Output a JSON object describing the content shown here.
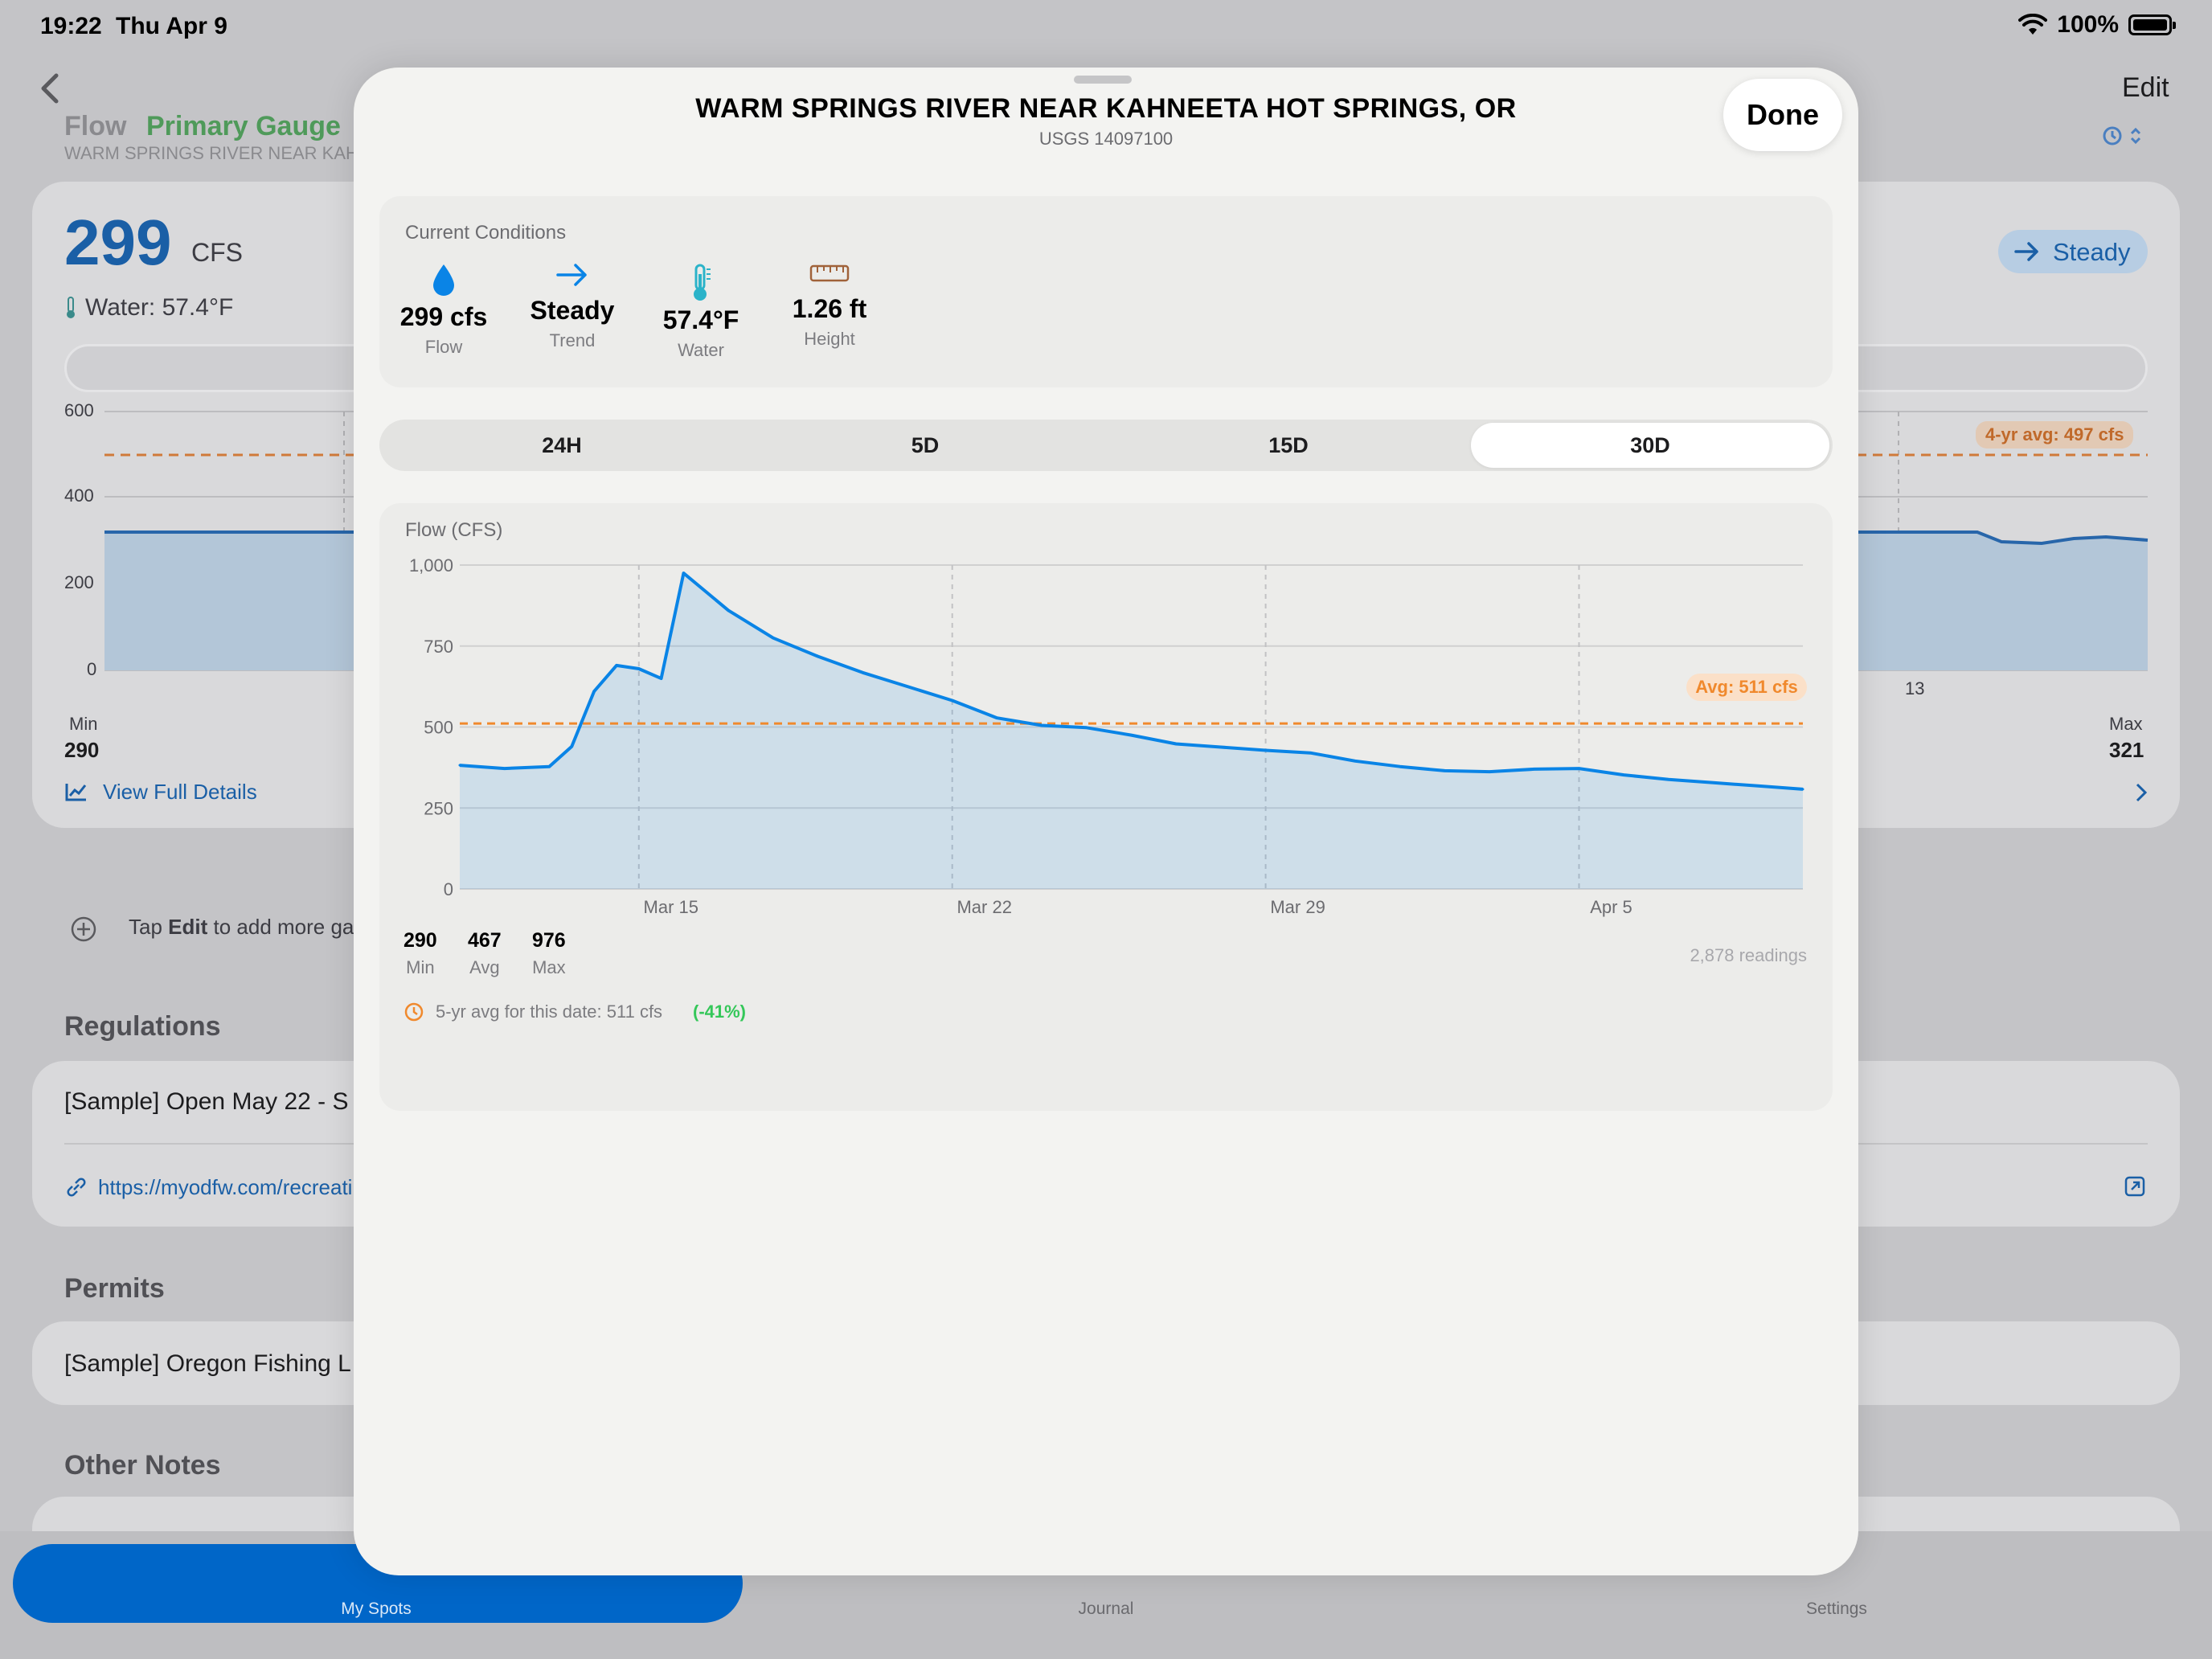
{
  "status": {
    "time": "19:22",
    "date": "Thu Apr 9",
    "battery": "100%"
  },
  "background": {
    "edit_label": "Edit",
    "header": {
      "flow_label": "Flow",
      "primary_gauge": "Primary Gauge",
      "gauge_name": "WARM SPRINGS RIVER NEAR KAH"
    },
    "flow_card": {
      "value": "299",
      "unit": "CFS",
      "water": "Water: 57.4°F",
      "trend": "Steady",
      "y_ticks": [
        "600",
        "400",
        "200",
        "0"
      ],
      "avg_badge": "4-yr avg: 497 cfs",
      "x_tick_right": "13",
      "min_label": "Min",
      "min_value": "290",
      "max_label": "Max",
      "max_value": "321",
      "view_details": "View Full Details"
    },
    "tap_edit": {
      "prefix": "Tap ",
      "bold": "Edit",
      "suffix": " to add more gau"
    },
    "regulations": {
      "title": "Regulations",
      "item": "[Sample] Open May 22 - S",
      "link": "https://myodfw.com/recreati"
    },
    "permits": {
      "title": "Permits",
      "item": "[Sample] Oregon Fishing L"
    },
    "other_notes": {
      "title": "Other Notes"
    },
    "tabs": {
      "my_spots": "My Spots",
      "journal": "Journal",
      "settings": "Settings"
    }
  },
  "sheet": {
    "title": "WARM SPRINGS RIVER NEAR KAHNEETA HOT SPRINGS, OR",
    "subtitle": "USGS 14097100",
    "done_label": "Done",
    "current_conditions": {
      "label": "Current Conditions",
      "metrics": [
        {
          "value": "299 cfs",
          "caption": "Flow",
          "icon": "water-drop-icon"
        },
        {
          "value": "Steady",
          "caption": "Trend",
          "icon": "arrow-right-icon"
        },
        {
          "value": "57.4°F",
          "caption": "Water",
          "icon": "thermometer-icon"
        },
        {
          "value": "1.26 ft",
          "caption": "Height",
          "icon": "ruler-icon"
        }
      ]
    },
    "ranges": [
      "24H",
      "5D",
      "15D",
      "30D"
    ],
    "selected_range": "30D",
    "chart_stats": {
      "min_value": "290",
      "min_label": "Min",
      "avg_value": "467",
      "avg_label": "Avg",
      "max_value": "976",
      "max_label": "Max",
      "readings": "2,878 readings",
      "five_yr_text": "5-yr avg for this date: 511 cfs",
      "five_yr_delta": "(-41%)"
    },
    "colors": {
      "accent": "#0a84e6",
      "avg_line": "#f0892d",
      "positive": "#34c759"
    }
  },
  "chart_data": {
    "type": "area",
    "ylabel": "Flow (CFS)",
    "ylim": [
      0,
      1000
    ],
    "y_ticks": [
      0,
      250,
      500,
      750,
      1000
    ],
    "y_tick_labels": [
      "0",
      "250",
      "500",
      "750",
      "1,000"
    ],
    "x_range": [
      "2026-03-10",
      "2026-04-09"
    ],
    "x_ticks": [
      "Mar 15",
      "Mar 22",
      "Mar 29",
      "Apr 5"
    ],
    "x_tick_dates": [
      "2026-03-14",
      "2026-03-21",
      "2026-03-28",
      "2026-04-04"
    ],
    "avg_line": {
      "value": 511,
      "label": "Avg: 511 cfs"
    },
    "grid": true,
    "series": [
      {
        "x": [
          "2026-03-10",
          "2026-03-11",
          "2026-03-12",
          "2026-03-12T12:00",
          "2026-03-13",
          "2026-03-13T12:00",
          "2026-03-14",
          "2026-03-14T12:00",
          "2026-03-15",
          "2026-03-16",
          "2026-03-17",
          "2026-03-18",
          "2026-03-19",
          "2026-03-20",
          "2026-03-21",
          "2026-03-22",
          "2026-03-23",
          "2026-03-24",
          "2026-03-25",
          "2026-03-26",
          "2026-03-27",
          "2026-03-28",
          "2026-03-29",
          "2026-03-30",
          "2026-03-31",
          "2026-04-01",
          "2026-04-02",
          "2026-04-03",
          "2026-04-04",
          "2026-04-05",
          "2026-04-06",
          "2026-04-07",
          "2026-04-08",
          "2026-04-09"
        ],
        "values": [
          382,
          372,
          378,
          440,
          610,
          690,
          680,
          650,
          975,
          860,
          775,
          718,
          668,
          625,
          582,
          528,
          505,
          498,
          475,
          448,
          438,
          428,
          420,
          395,
          378,
          365,
          362,
          370,
          372,
          352,
          338,
          328,
          318,
          308
        ]
      }
    ]
  }
}
